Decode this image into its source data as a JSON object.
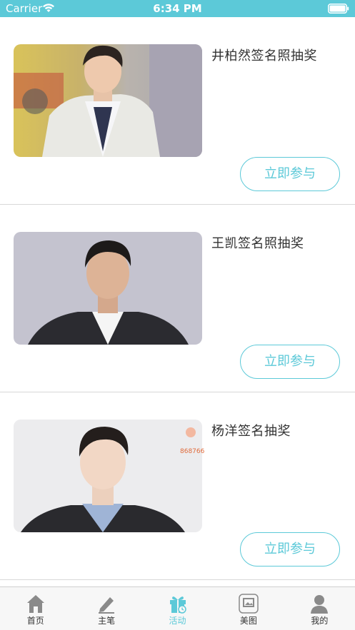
{
  "status_bar": {
    "carrier": "Carrier",
    "time": "6:34 PM"
  },
  "colors": {
    "accent": "#5cc9d8",
    "tab_inactive": "#8a8a8a"
  },
  "activities": [
    {
      "title": "井柏然签名照抽奖",
      "button_label": "立即参与",
      "image_icon": "portrait-photo"
    },
    {
      "title": "王凯签名照抽奖",
      "button_label": "立即参与",
      "image_icon": "portrait-photo"
    },
    {
      "title": "杨洋签名抽奖",
      "button_label": "立即参与",
      "image_icon": "portrait-photo",
      "watermark": "868766"
    }
  ],
  "tabs": [
    {
      "label": "首页",
      "icon": "home-icon",
      "active": false
    },
    {
      "label": "主笔",
      "icon": "pencil-icon",
      "active": false
    },
    {
      "label": "活动",
      "icon": "gift-icon",
      "active": true
    },
    {
      "label": "美图",
      "icon": "gallery-icon",
      "active": false
    },
    {
      "label": "我的",
      "icon": "user-icon",
      "active": false
    }
  ]
}
